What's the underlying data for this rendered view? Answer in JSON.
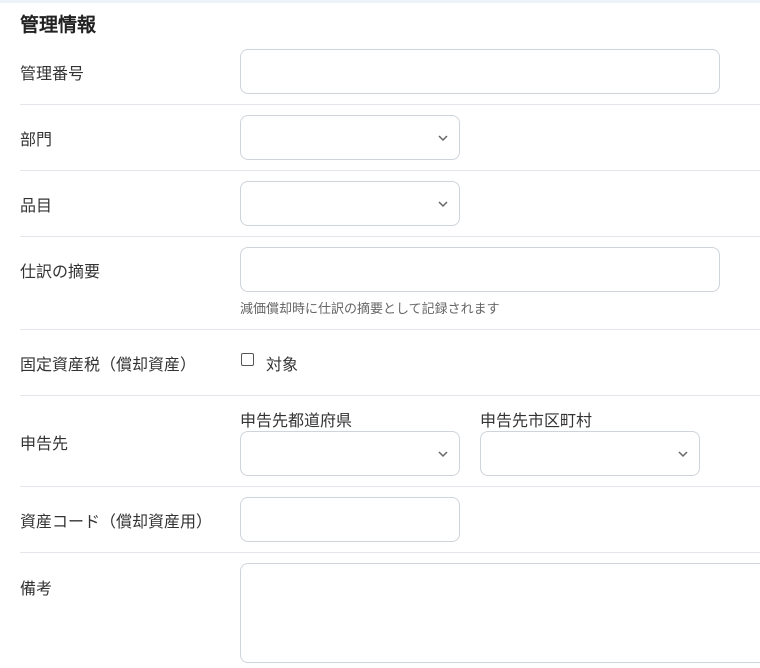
{
  "section": {
    "title": "管理情報"
  },
  "fields": {
    "management_number": {
      "label": "管理番号",
      "value": "",
      "placeholder": ""
    },
    "department": {
      "label": "部門",
      "selected": ""
    },
    "item": {
      "label": "品目",
      "selected": ""
    },
    "journal_memo": {
      "label": "仕訳の摘要",
      "value": "",
      "help": "減価償却時に仕訳の摘要として記録されます"
    },
    "fixed_asset_tax": {
      "label": "固定資産税（償却資産）",
      "checkbox_label": "対象",
      "checked": false
    },
    "filing_destination": {
      "label": "申告先",
      "prefecture_label": "申告先都道府県",
      "prefecture_selected": "",
      "municipality_label": "申告先市区町村",
      "municipality_selected": ""
    },
    "asset_code": {
      "label": "資産コード（償却資産用）",
      "value": ""
    },
    "remarks": {
      "label": "備考",
      "value": ""
    }
  },
  "icons": {
    "select_arrow": "chevron-down-icon"
  },
  "colors": {
    "border": "#cfd4da",
    "divider": "#e3e6ea",
    "text": "#333333",
    "help": "#666666"
  }
}
